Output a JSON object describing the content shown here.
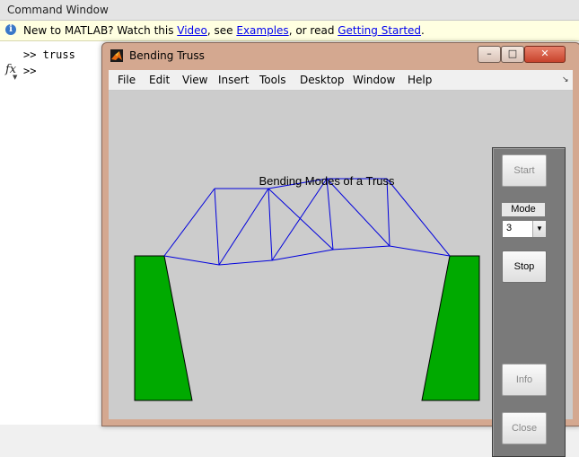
{
  "command_window": {
    "title": "Command Window",
    "info": {
      "prefix": "New to MATLAB? Watch this ",
      "video_link": "Video",
      "mid1": ", see ",
      "examples_link": "Examples",
      "mid2": ", or read ",
      "getting_started_link": "Getting Started",
      "suffix": "."
    },
    "lines": [
      ">> truss",
      ">>"
    ],
    "fx_symbol": "fx"
  },
  "figure": {
    "title": "Bending Truss",
    "window_buttons": {
      "minimize": "–",
      "maximize": "□",
      "close": "✕"
    },
    "menu": [
      "File",
      "Edit",
      "View",
      "Insert",
      "Tools",
      "Desktop",
      "Window",
      "Help"
    ],
    "menu_overflow": "↘",
    "plot_title": "Bending Modes of a Truss",
    "panel": {
      "start_label": "Start",
      "mode_label": "Mode",
      "mode_value": "3",
      "stop_label": "Stop",
      "info_label": "Info",
      "close_label": "Close"
    }
  },
  "colors": {
    "support_fill": "#00aa00",
    "truss_stroke": "#0000dd",
    "canvas_bg": "#cccccc"
  }
}
